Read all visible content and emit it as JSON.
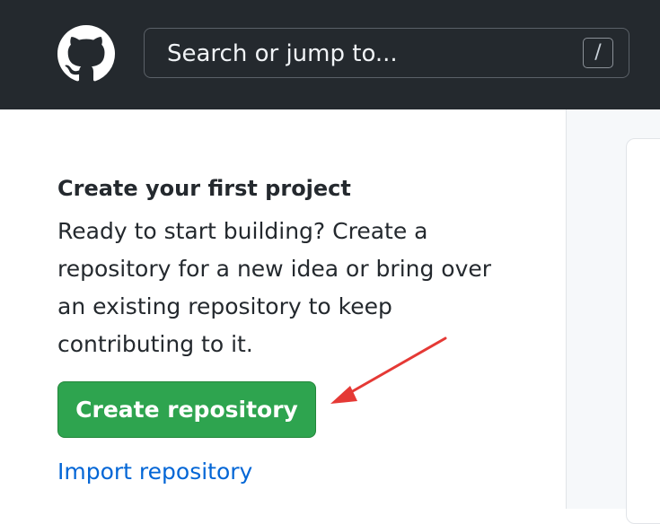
{
  "header": {
    "logo_icon": "github-octocat-icon",
    "search": {
      "placeholder": "Search or jump to...",
      "shortcut_key": "/"
    },
    "background_color": "#24292e"
  },
  "main": {
    "title": "Create your first project",
    "description_lines": [
      "Ready to start building? Create a",
      "repository for a new idea or bring over",
      "an existing repository to keep",
      "contributing to it."
    ],
    "create_button_label": "Create repository",
    "import_link_label": "Import repository"
  },
  "colors": {
    "create_button": "#2ea44f",
    "link": "#0366d6",
    "annotation_arrow": "#e53935"
  },
  "annotation": {
    "arrow_icon": "red-arrow-icon"
  }
}
